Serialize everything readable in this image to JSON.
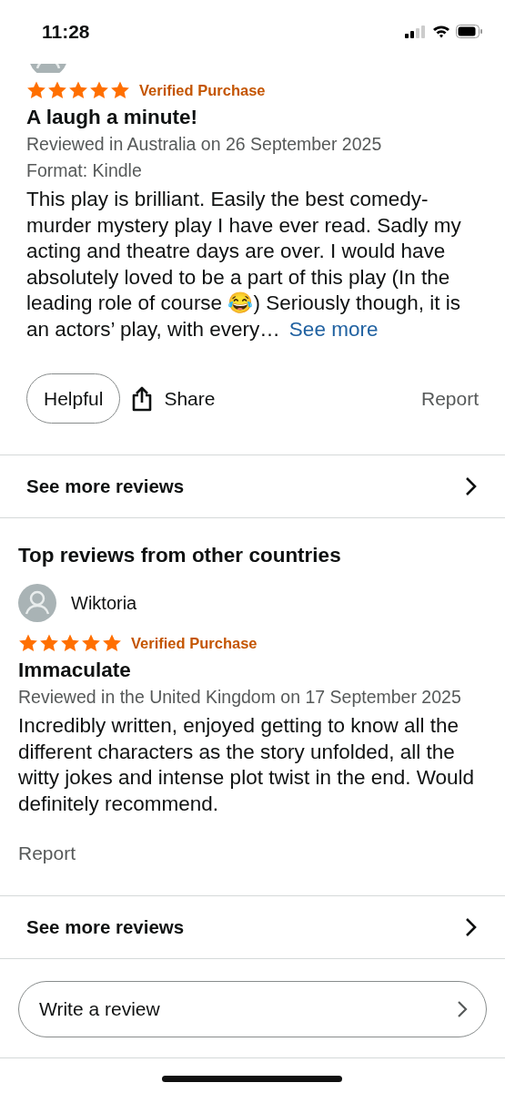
{
  "status_bar": {
    "time": "11:28"
  },
  "reviews": [
    {
      "stars": 5,
      "badge": "Verified Purchase",
      "title": "A laugh a minute!",
      "meta": [
        "Reviewed in Australia on 26 September 2025",
        "Format: Kindle"
      ],
      "body": "This play is brilliant. Easily the best comedy-murder mystery play I have ever read. Sadly my acting and theatre days are over. I would have absolutely loved to be a part of this play (In the leading role of course 😂) Seriously though, it is an actors’ play, with every…",
      "see_more": "See more",
      "actions": [
        {
          "kind": "helpful",
          "label": "Helpful"
        },
        {
          "kind": "share",
          "label": "Share"
        },
        {
          "kind": "report",
          "label": "Report"
        }
      ]
    }
  ],
  "see_more_reviews": "See more reviews",
  "other_countries": {
    "heading": "Top reviews from other countries",
    "reviews": [
      {
        "author": "Wiktoria",
        "stars": 5,
        "badge": "Verified Purchase",
        "title": "Immaculate",
        "meta": [
          "Reviewed in the United Kingdom on 17 September 2025"
        ],
        "body": "Incredibly written, enjoyed getting to know all the different characters as the story unfolded, all the witty jokes and intense plot twist in the end. Would definitely recommend.",
        "actions": [
          {
            "kind": "report",
            "label": "Report"
          }
        ]
      }
    ],
    "see_more_reviews": "See more reviews"
  },
  "write_review": "Write a review"
}
